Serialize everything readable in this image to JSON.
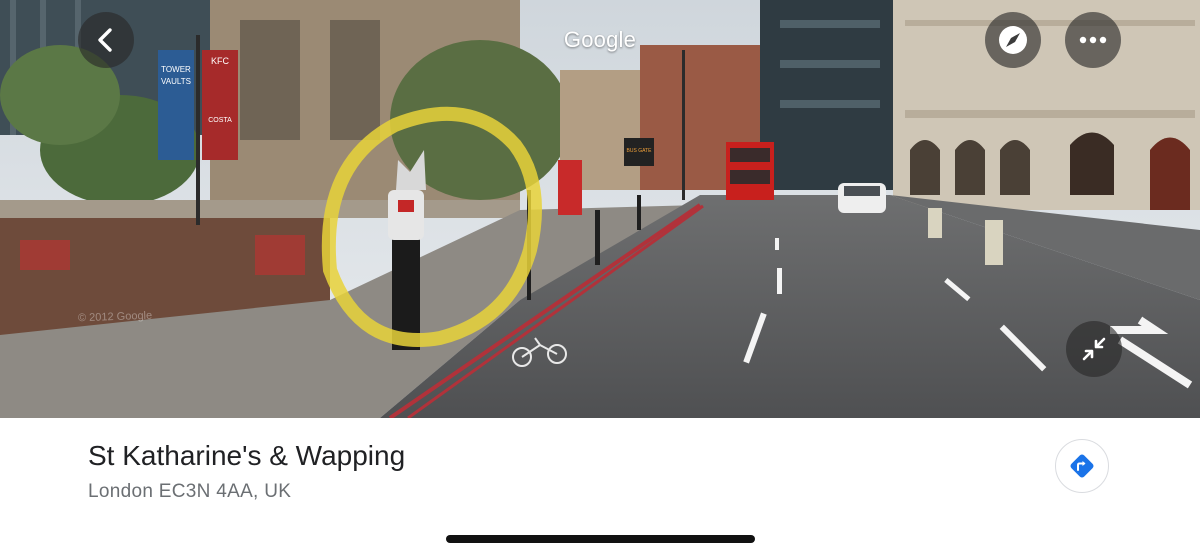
{
  "viewer": {
    "title": "Google",
    "watermark": "© 2012 Google",
    "back_icon": "chevron-left-icon",
    "compass_icon": "compass-icon",
    "more_icon": "more-horizontal-icon",
    "collapse_icon": "collapse-arrows-icon",
    "overlay_color": "#e8d23a"
  },
  "place": {
    "name": "St Katharine's & Wapping",
    "address": "London EC3N 4AA, UK",
    "directions_icon": "directions-icon",
    "directions_color": "#1a73e8"
  },
  "scene_signs": {
    "banner_left_line1": "TOWER",
    "banner_left_line2": "VAULTS",
    "banner_right_top": "KFC",
    "banner_right_bottom": "COSTA",
    "bus_display": "BUS GATE"
  }
}
